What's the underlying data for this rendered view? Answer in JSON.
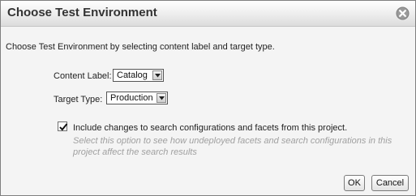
{
  "dialog": {
    "title": "Choose Test Environment",
    "close_icon": "close-icon",
    "description": "Choose Test Environment by selecting content label and target type.",
    "content_label": {
      "label": "Content Label:",
      "value": "Catalog"
    },
    "target_type": {
      "label": "Target Type:",
      "value": "Production"
    },
    "include_changes": {
      "checked": true,
      "label": "Include changes to search configurations and facets from this project.",
      "hint": "Select this option to see how undeployed facets and search configurations in this project affect the search results"
    },
    "buttons": {
      "ok": "OK",
      "cancel": "Cancel"
    }
  }
}
